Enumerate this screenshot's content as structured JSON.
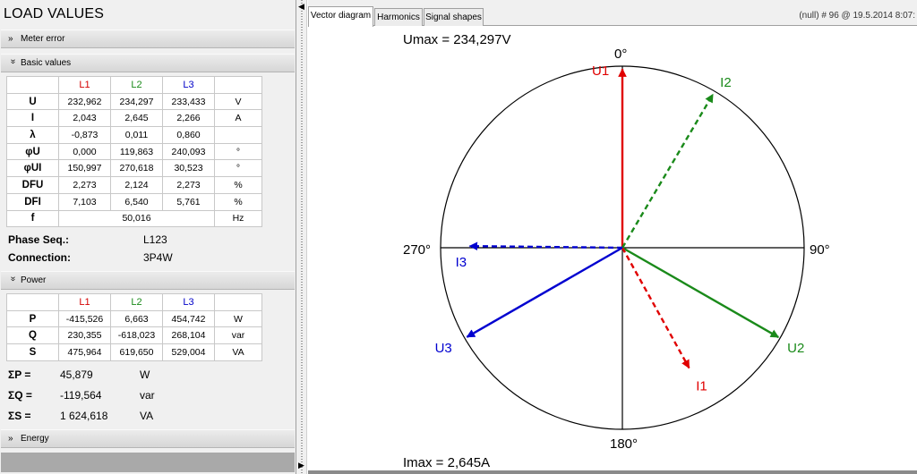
{
  "left": {
    "title": "LOAD VALUES",
    "sections": {
      "meter_error": {
        "label": "Meter error",
        "chev": "»"
      },
      "basic_values": {
        "label": "Basic values",
        "chev": "»"
      },
      "power": {
        "label": "Power",
        "chev": "»"
      },
      "energy": {
        "label": "Energy",
        "chev": "»"
      }
    },
    "headers": [
      "L1",
      "L2",
      "L3"
    ],
    "basic": [
      {
        "sym": "U",
        "l1": "232,962",
        "l2": "234,297",
        "l3": "233,433",
        "unit": "V"
      },
      {
        "sym": "I",
        "l1": "2,043",
        "l2": "2,645",
        "l3": "2,266",
        "unit": "A"
      },
      {
        "sym": "λ",
        "l1": "-0,873",
        "l2": "0,011",
        "l3": "0,860",
        "unit": ""
      },
      {
        "sym": "φU",
        "l1": "0,000",
        "l2": "119,863",
        "l3": "240,093",
        "unit": "°"
      },
      {
        "sym": "φUI",
        "l1": "150,997",
        "l2": "270,618",
        "l3": "30,523",
        "unit": "°"
      },
      {
        "sym": "DFU",
        "l1": "2,273",
        "l2": "2,124",
        "l3": "2,273",
        "unit": "%"
      },
      {
        "sym": "DFI",
        "l1": "7,103",
        "l2": "6,540",
        "l3": "5,761",
        "unit": "%"
      },
      {
        "sym": "f",
        "span": "50,016",
        "unit": "Hz"
      }
    ],
    "phase_seq": {
      "label": "Phase Seq.:",
      "value": "L123"
    },
    "connection": {
      "label": "Connection:",
      "value": "3P4W"
    },
    "power": [
      {
        "sym": "P",
        "l1": "-415,526",
        "l2": "6,663",
        "l3": "454,742",
        "unit": "W"
      },
      {
        "sym": "Q",
        "l1": "230,355",
        "l2": "-618,023",
        "l3": "268,104",
        "unit": "var"
      },
      {
        "sym": "S",
        "l1": "475,964",
        "l2": "619,650",
        "l3": "529,004",
        "unit": "VA"
      }
    ],
    "totals": [
      {
        "label": "ΣP =",
        "value": "45,879",
        "unit": "W"
      },
      {
        "label": "ΣQ =",
        "value": "-119,564",
        "unit": "var"
      },
      {
        "label": "ΣS =",
        "value": "1 624,618",
        "unit": "VA"
      }
    ]
  },
  "right": {
    "tabs": [
      "Vector diagram",
      "Harmonics",
      "Signal shapes"
    ],
    "info": "(null) # 96 @ 19.5.2014 8:07:",
    "umax": "Umax = 234,297V",
    "imax": "Imax = 2,645A",
    "angle_labels": {
      "top": "0°",
      "right": "90°",
      "bottom": "180°",
      "left": "270°"
    },
    "colors": {
      "L1": "#e00000",
      "L2": "#1a8a1a",
      "L3": "#0000d0"
    },
    "vectors": [
      {
        "name": "U1",
        "angle": 0.0,
        "mag": 232.962,
        "max": 234.297,
        "phase": "L1",
        "dashed": false
      },
      {
        "name": "U2",
        "angle": 119.863,
        "mag": 234.297,
        "max": 234.297,
        "phase": "L2",
        "dashed": false
      },
      {
        "name": "U3",
        "angle": 240.093,
        "mag": 233.433,
        "max": 234.297,
        "phase": "L3",
        "dashed": false
      },
      {
        "name": "I1",
        "angle": 150.997,
        "mag": 2.043,
        "max": 2.645,
        "phase": "L1",
        "dashed": true
      },
      {
        "name": "I2",
        "angle": 30.523,
        "mag": 2.645,
        "max": 2.645,
        "phase": "L2",
        "dashed": true
      },
      {
        "name": "I3",
        "angle": 270.618,
        "mag": 2.266,
        "max": 2.645,
        "phase": "L3",
        "dashed": true
      }
    ]
  }
}
